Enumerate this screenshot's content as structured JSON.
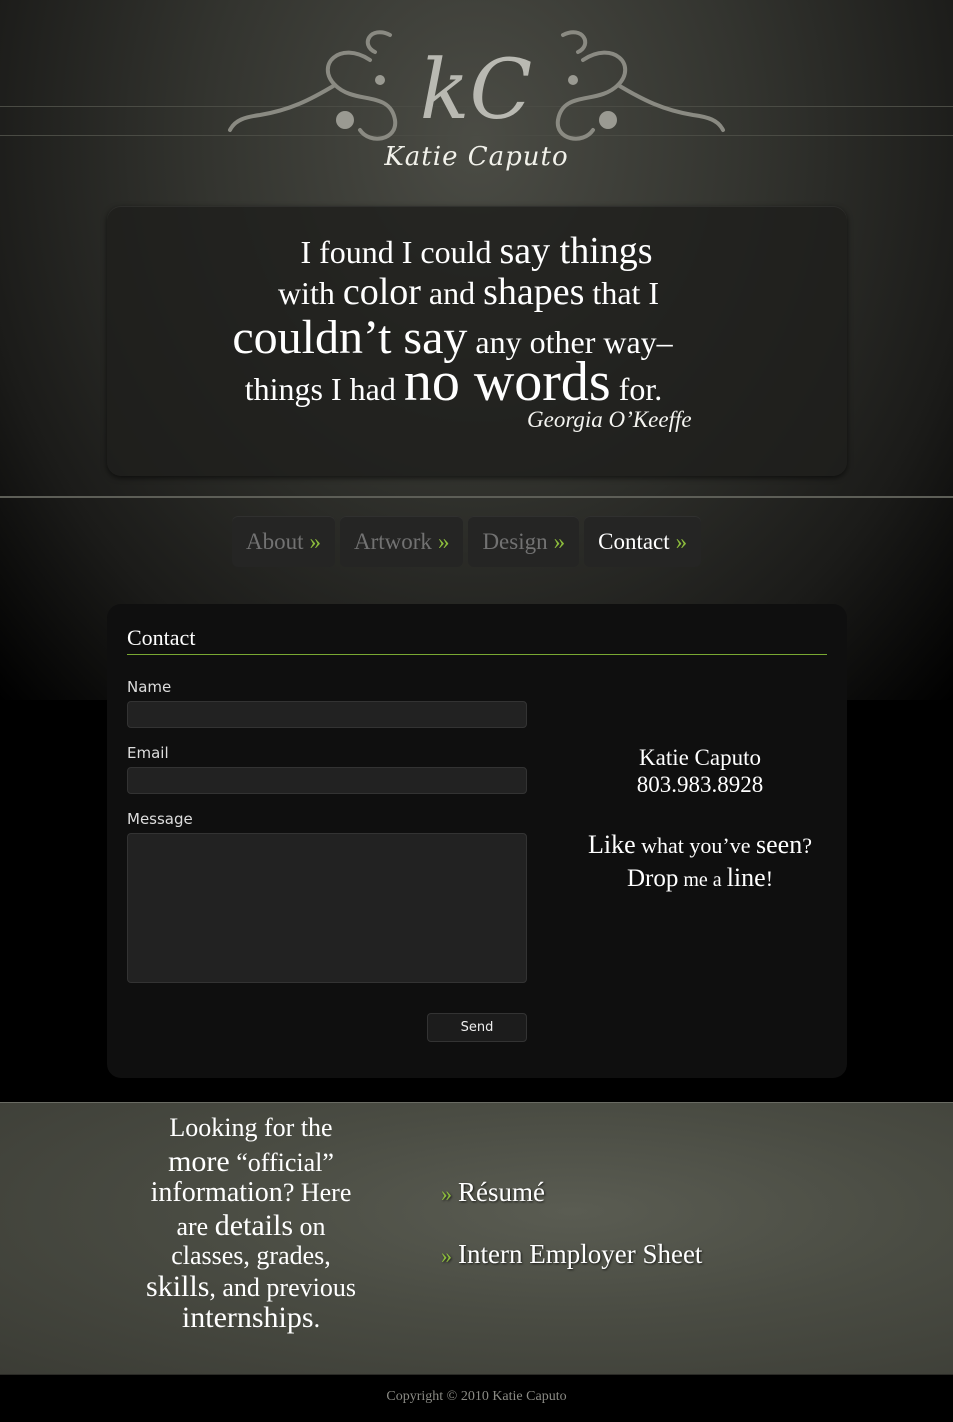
{
  "header": {
    "logo_monogram": "kC",
    "logo_name": "Katie Caputo"
  },
  "quote": {
    "line1": [
      "I found I could ",
      "say things"
    ],
    "line2": [
      "with ",
      "color",
      " and ",
      "shapes",
      " that I"
    ],
    "line3": [
      "couldn’t say",
      " any other way–"
    ],
    "line4": [
      "things I had ",
      "no words",
      " for."
    ],
    "author": "Georgia O’Keeffe"
  },
  "nav": {
    "items": [
      {
        "label": "About",
        "arrow": "»"
      },
      {
        "label": "Artwork",
        "arrow": "»"
      },
      {
        "label": "Design",
        "arrow": "»"
      },
      {
        "label": "Contact",
        "arrow": "»"
      }
    ],
    "active": "Contact"
  },
  "contact": {
    "title": "Contact",
    "name_label": "Name",
    "email_label": "Email",
    "message_label": "Message",
    "send_label": "Send",
    "name_value": "",
    "email_value": "",
    "message_value": ""
  },
  "info": {
    "name": "Katie Caputo",
    "phone": "803.983.8928",
    "cta_line1": [
      "Like",
      " what you’ve ",
      "seen",
      "?"
    ],
    "cta_line2": [
      "Drop",
      " me a ",
      "line",
      "!"
    ]
  },
  "official": {
    "line1": "Looking for the",
    "line2": [
      "more",
      " “official”"
    ],
    "line3": [
      "information",
      "? Here"
    ],
    "line4": [
      "are ",
      "details",
      " on"
    ],
    "line5": "classes, grades,",
    "line6": [
      "skills",
      ", and previous"
    ],
    "line7": [
      "internships",
      "."
    ]
  },
  "links": {
    "arrow": "»",
    "resume": "Résumé",
    "intern_sheet": "Intern Employer Sheet"
  },
  "footer": {
    "copyright": "Copyright © 2010 Katie Caputo"
  },
  "colors": {
    "accent": "#8cbc3c",
    "panel": "#0f0f0f",
    "quote_box": "#1e1e1c"
  }
}
